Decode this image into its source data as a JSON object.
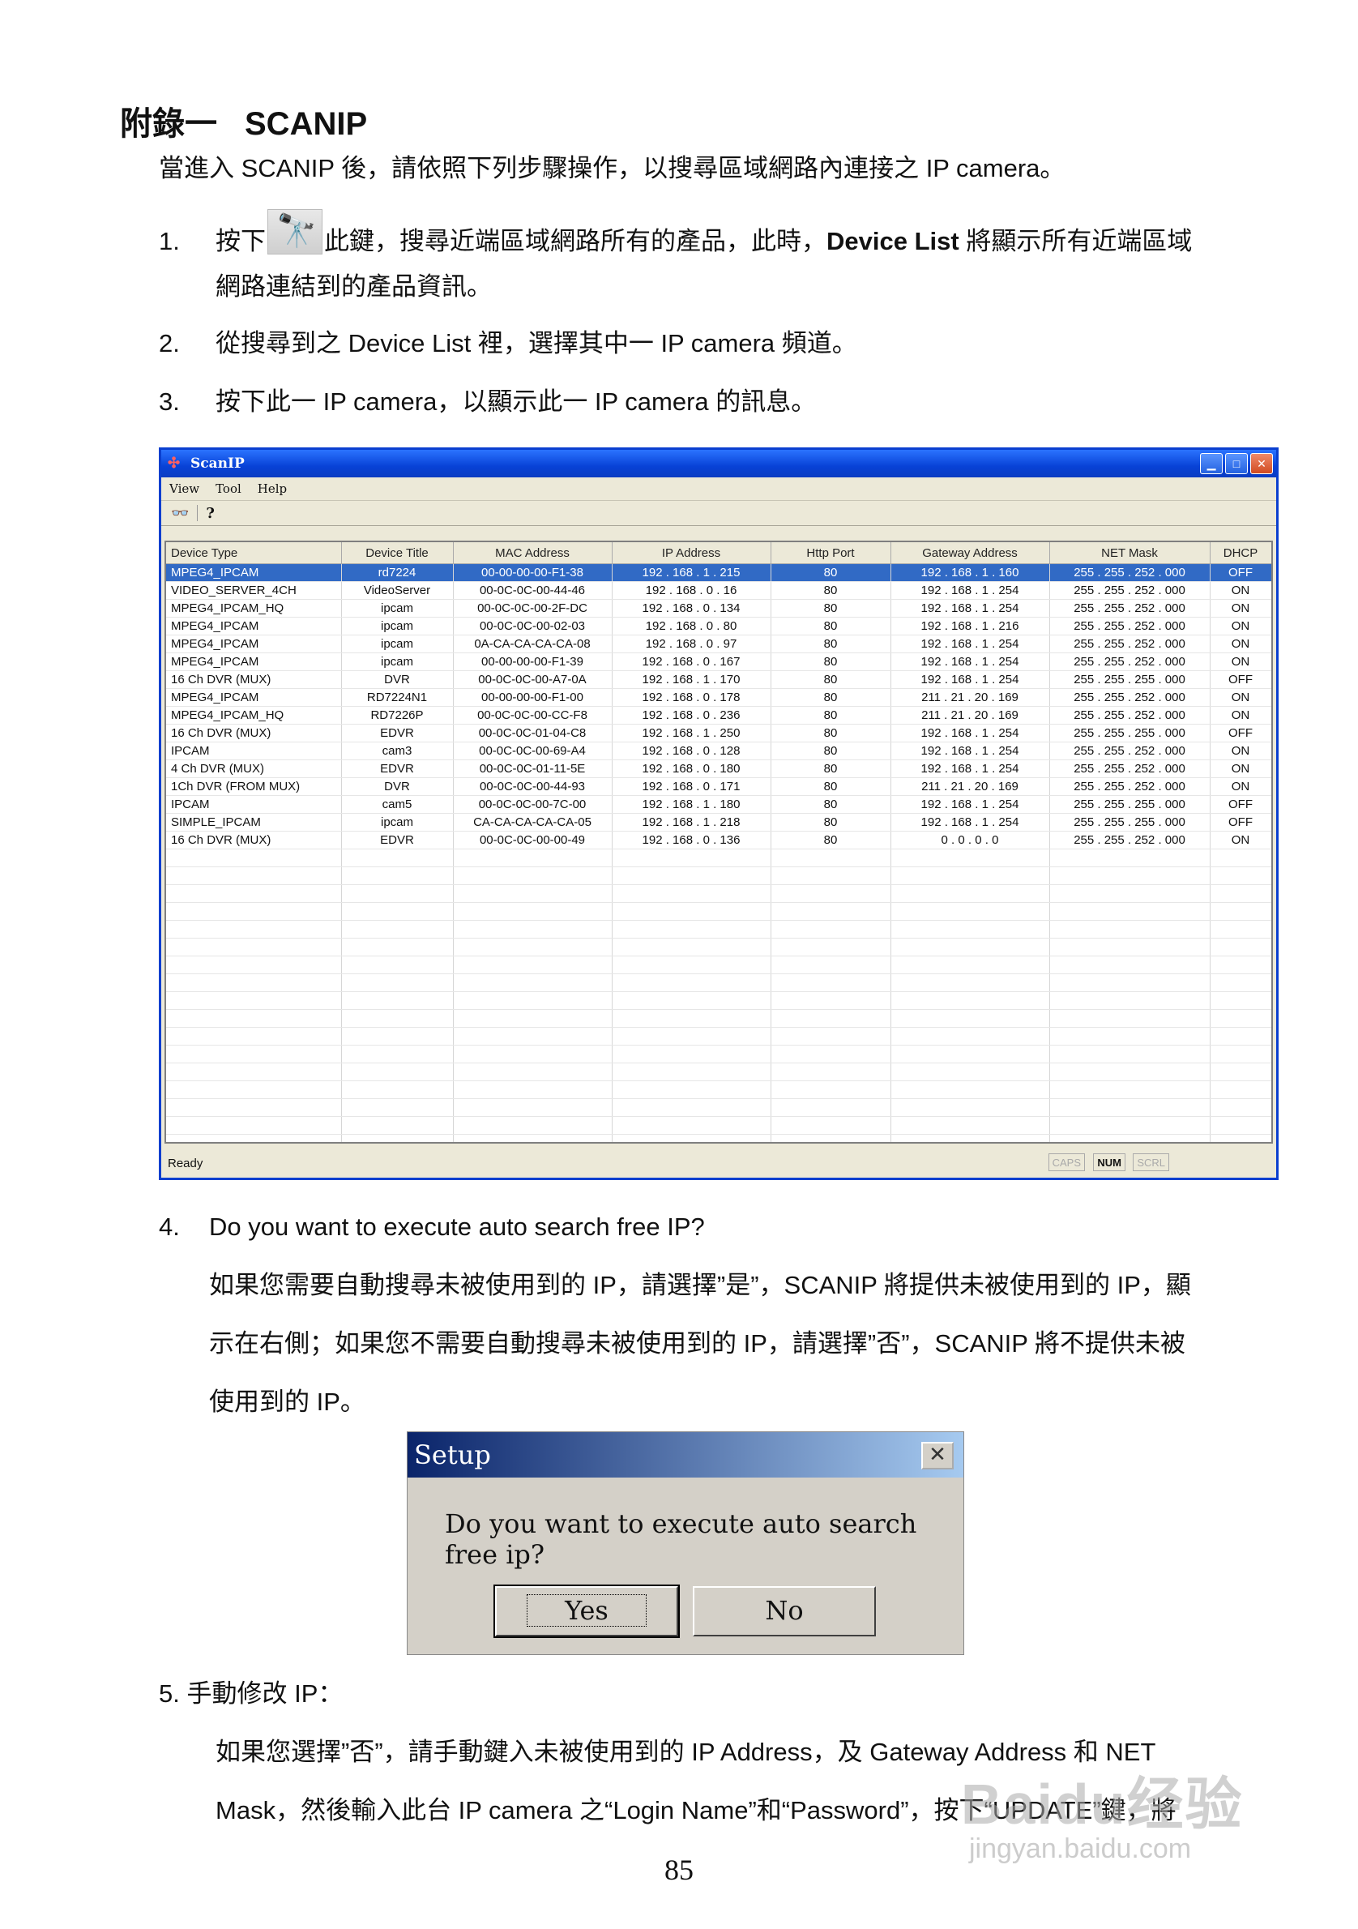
{
  "heading": {
    "prefix": "附錄一",
    "title": "SCANIP"
  },
  "intro": "當進入 SCANIP 後，請依照下列步驟操作，以搜尋區域網路內連接之 IP camera。",
  "steps": {
    "s1": {
      "num": "1.",
      "before": "按下",
      "after_a": "此鍵，搜尋近端區域網路所有的產品，此時，",
      "bold": "Device List",
      "after_b": " 將顯示所有近端區域",
      "line2": "網路連結到的產品資訊。"
    },
    "s2": {
      "num": "2.",
      "text": "從搜尋到之 Device List 裡，選擇其中一 IP camera 頻道。"
    },
    "s3": {
      "num": "3.",
      "text": "按下此一 IP camera，以顯示此一 IP camera 的訊息。"
    },
    "s4": {
      "num": "4.",
      "title": "Do you want to execute auto search free IP?",
      "lines": [
        "如果您需要自動搜尋未被使用到的 IP，請選擇”是”，SCANIP 將提供未被使用到的 IP，顯",
        "示在右側；如果您不需要自動搜尋未被使用到的 IP，請選擇”否”，SCANIP 將不提供未被",
        "使用到的 IP。"
      ]
    },
    "s5": {
      "title": "5.  手動修改 IP：",
      "lines": [
        "如果您選擇”否”，請手動鍵入未被使用到的 IP Address，及 Gateway Address 和 NET",
        "Mask，然後輸入此台 IP camera 之“Login Name”和“Password”，按下“UPDATE”鍵，將"
      ]
    }
  },
  "scanip": {
    "title": "ScanIP",
    "menu": [
      "View",
      "Tool",
      "Help"
    ],
    "columns": [
      "Device Type",
      "Device Title",
      "MAC Address",
      "IP Address",
      "Http Port",
      "Gateway Address",
      "NET Mask",
      "DHCP"
    ],
    "rows": [
      [
        "MPEG4_IPCAM",
        "rd7224",
        "00-00-00-00-F1-38",
        "192 . 168 . 1 . 215",
        "80",
        "192 . 168 . 1 . 160",
        "255 . 255 . 252 . 000",
        "OFF"
      ],
      [
        "VIDEO_SERVER_4CH",
        "VideoServer",
        "00-0C-0C-00-44-46",
        "192 . 168 . 0 . 16",
        "80",
        "192 . 168 . 1 . 254",
        "255 . 255 . 252 . 000",
        "ON"
      ],
      [
        "MPEG4_IPCAM_HQ",
        "ipcam",
        "00-0C-0C-00-2F-DC",
        "192 . 168 . 0 . 134",
        "80",
        "192 . 168 . 1 . 254",
        "255 . 255 . 252 . 000",
        "ON"
      ],
      [
        "MPEG4_IPCAM",
        "ipcam",
        "00-0C-0C-00-02-03",
        "192 . 168 . 0 . 80",
        "80",
        "192 . 168 . 1 . 216",
        "255 . 255 . 252 . 000",
        "ON"
      ],
      [
        "MPEG4_IPCAM",
        "ipcam",
        "0A-CA-CA-CA-CA-08",
        "192 . 168 . 0 . 97",
        "80",
        "192 . 168 . 1 . 254",
        "255 . 255 . 252 . 000",
        "ON"
      ],
      [
        "MPEG4_IPCAM",
        "ipcam",
        "00-00-00-00-F1-39",
        "192 . 168 . 0 . 167",
        "80",
        "192 . 168 . 1 . 254",
        "255 . 255 . 252 . 000",
        "ON"
      ],
      [
        "16 Ch DVR (MUX)",
        "DVR",
        "00-0C-0C-00-A7-0A",
        "192 . 168 . 1 . 170",
        "80",
        "192 . 168 . 1 . 254",
        "255 . 255 . 255 . 000",
        "OFF"
      ],
      [
        "MPEG4_IPCAM",
        "RD7224N1",
        "00-00-00-00-F1-00",
        "192 . 168 . 0 . 178",
        "80",
        "211 . 21 . 20 . 169",
        "255 . 255 . 252 . 000",
        "ON"
      ],
      [
        "MPEG4_IPCAM_HQ",
        "RD7226P",
        "00-0C-0C-00-CC-F8",
        "192 . 168 . 0 . 236",
        "80",
        "211 . 21 . 20 . 169",
        "255 . 255 . 252 . 000",
        "ON"
      ],
      [
        "16 Ch DVR (MUX)",
        "EDVR",
        "00-0C-0C-01-04-C8",
        "192 . 168 . 1 . 250",
        "80",
        "192 . 168 . 1 . 254",
        "255 . 255 . 255 . 000",
        "OFF"
      ],
      [
        "IPCAM",
        "cam3",
        "00-0C-0C-00-69-A4",
        "192 . 168 . 0 . 128",
        "80",
        "192 . 168 . 1 . 254",
        "255 . 255 . 252 . 000",
        "ON"
      ],
      [
        "4 Ch DVR (MUX)",
        "EDVR",
        "00-0C-0C-01-11-5E",
        "192 . 168 . 0 . 180",
        "80",
        "192 . 168 . 1 . 254",
        "255 . 255 . 252 . 000",
        "ON"
      ],
      [
        "1Ch DVR (FROM MUX)",
        "DVR",
        "00-0C-0C-00-44-93",
        "192 . 168 . 0 . 171",
        "80",
        "211 . 21 . 20 . 169",
        "255 . 255 . 252 . 000",
        "ON"
      ],
      [
        "IPCAM",
        "cam5",
        "00-0C-0C-00-7C-00",
        "192 . 168 . 1 . 180",
        "80",
        "192 . 168 . 1 . 254",
        "255 . 255 . 255 . 000",
        "OFF"
      ],
      [
        "SIMPLE_IPCAM",
        "ipcam",
        "CA-CA-CA-CA-CA-05",
        "192 . 168 . 1 . 218",
        "80",
        "192 . 168 . 1 . 254",
        "255 . 255 . 255 . 000",
        "OFF"
      ],
      [
        "16 Ch DVR (MUX)",
        "EDVR",
        "00-0C-0C-00-00-49",
        "192 . 168 . 0 . 136",
        "80",
        "0 . 0 . 0 . 0",
        "255 . 255 . 252 . 000",
        "ON"
      ]
    ],
    "selected_row": 0,
    "status": {
      "text": "Ready",
      "caps": "CAPS",
      "num": "NUM",
      "scrl": "SCRL"
    }
  },
  "dialog": {
    "title": "Setup",
    "message": "Do you want to execute auto search free ip?",
    "yes": "Yes",
    "no": "No"
  },
  "page_number": "85",
  "watermark": {
    "logo": "Baidu经验",
    "url": "jingyan.baidu.com"
  },
  "colors": {
    "selection": "#316ac5",
    "titlebar": "#0842d6"
  }
}
